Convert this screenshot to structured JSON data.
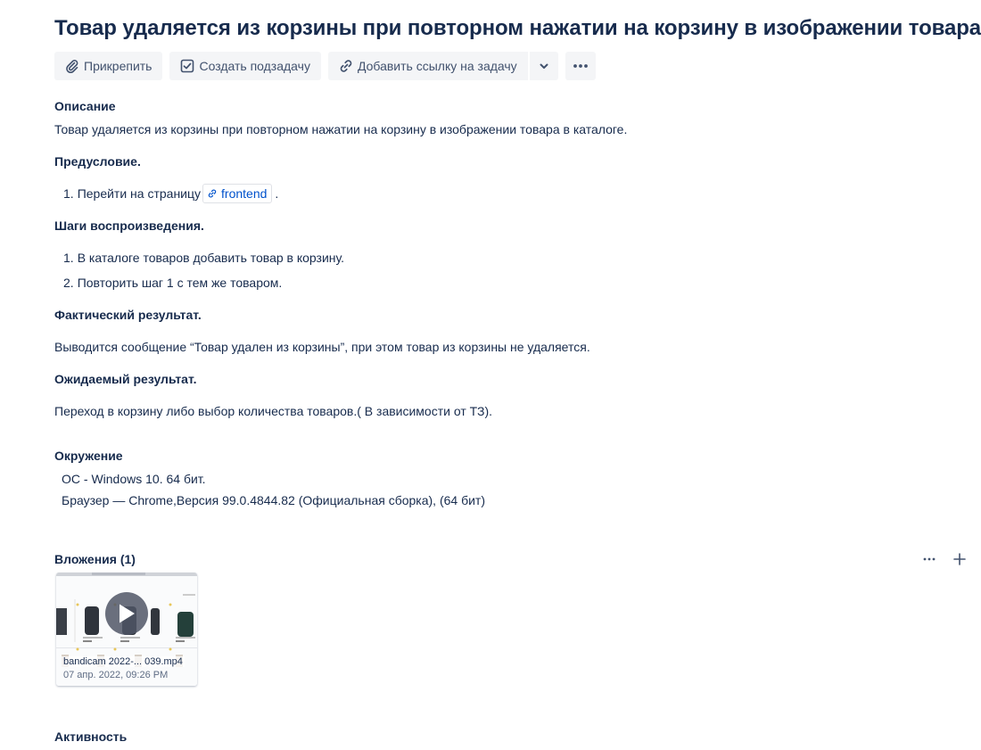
{
  "issue": {
    "title": "Товар удаляется из корзины при повторном нажатии на корзину в изображении товара."
  },
  "toolbar": {
    "attach": {
      "label": "Прикрепить",
      "icon": "paperclip-icon"
    },
    "subtask": {
      "label": "Создать подзадачу",
      "icon": "checkbox-icon"
    },
    "link": {
      "label": "Добавить ссылку на задачу",
      "icon": "link-icon"
    },
    "dropdown_icon": "chevron-down-icon",
    "more_icon": "more-icon"
  },
  "description": {
    "heading": "Описание",
    "intro": "Товар удаляется из корзины при повторном нажатии на корзину в изображении товара в каталоге.",
    "precondition_heading": "Предусловие.",
    "precondition_items": [
      {
        "num": "1.",
        "text": "Перейти на страницу",
        "link": "frontend",
        "suffix": "."
      }
    ],
    "steps_heading": "Шаги воспроизведения.",
    "steps": [
      {
        "num": "1.",
        "text": "В каталоге товаров добавить товар в корзину."
      },
      {
        "num": "2.",
        "text": "Повторить шаг 1 с тем же товаром."
      }
    ],
    "actual_heading": "Фактический результат.",
    "actual_text": "Выводится сообщение “Товар удален из корзины”, при этом товар из корзины не удаляется.",
    "expected_heading": "Ожидаемый результат.",
    "expected_text": "Переход в корзину либо выбор количества товаров.( В зависимости от ТЗ)."
  },
  "environment": {
    "heading": "Окружение",
    "lines": [
      "ОС - Windows 10. 64 бит.",
      "Браузер — Chrome,Версия 99.0.4844.82 (Официальная сборка), (64 бит)"
    ]
  },
  "attachments": {
    "heading": "Вложения (1)",
    "items": [
      {
        "name": "bandicam 2022-... 039.mp4",
        "date": "07 апр. 2022, 09:26 PM"
      }
    ]
  },
  "activity": {
    "heading": "Активность"
  },
  "colors": {
    "text": "#172b4d",
    "link": "#0052cc",
    "button_bg": "#f4f5f7",
    "muted": "#5e6c84"
  }
}
